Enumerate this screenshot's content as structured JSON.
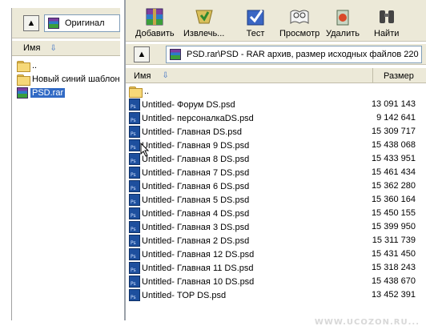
{
  "left": {
    "path_label": "Оригинал",
    "column_name": "Имя",
    "items": [
      {
        "type": "folder",
        "name": ".."
      },
      {
        "type": "folder",
        "name": "Новый синий шаблон"
      },
      {
        "type": "rar",
        "name": "PSD.rar",
        "selected": true
      }
    ]
  },
  "toolbar": [
    {
      "label": "Добавить",
      "icon": "add-archive-icon"
    },
    {
      "label": "Извлечь...",
      "icon": "extract-icon"
    },
    {
      "label": "Тест",
      "icon": "test-icon"
    },
    {
      "label": "Просмотр",
      "icon": "view-icon"
    },
    {
      "label": "Удалить",
      "icon": "delete-icon"
    },
    {
      "label": "Найти",
      "icon": "find-icon"
    }
  ],
  "right": {
    "path": "PSD.rar\\PSD - RAR архив, размер исходных файлов 220 «",
    "column_name": "Имя",
    "column_size": "Размер",
    "parent": "..",
    "files": [
      {
        "name": "Untitled- Форум DS.psd",
        "size": "13 091 143"
      },
      {
        "name": "Untitled- персоналкаDS.psd",
        "size": "9 142 641"
      },
      {
        "name": "Untitled- Главная DS.psd",
        "size": "15 309 717"
      },
      {
        "name": "Untitled- Главная 9 DS.psd",
        "size": "15 438 068"
      },
      {
        "name": "Untitled- Главная 8 DS.psd",
        "size": "15 433 951"
      },
      {
        "name": "Untitled- Главная 7 DS.psd",
        "size": "15 461 434"
      },
      {
        "name": "Untitled- Главная 6 DS.psd",
        "size": "15 362 280"
      },
      {
        "name": "Untitled- Главная 5 DS.psd",
        "size": "15 360 164"
      },
      {
        "name": "Untitled- Главная 4 DS.psd",
        "size": "15 450 155"
      },
      {
        "name": "Untitled- Главная 3 DS.psd",
        "size": "15 399 950"
      },
      {
        "name": "Untitled- Главная 2 DS.psd",
        "size": "15 311 739"
      },
      {
        "name": "Untitled- Главная 12 DS.psd",
        "size": "15 431 450"
      },
      {
        "name": "Untitled- Главная 11 DS.psd",
        "size": "15 318 243"
      },
      {
        "name": "Untitled- Главная 10 DS.psd",
        "size": "15 438 670"
      },
      {
        "name": "Untitled- TOP DS.psd",
        "size": "13 452 391"
      }
    ]
  },
  "watermark": "WWW.UCOZON.RU..."
}
